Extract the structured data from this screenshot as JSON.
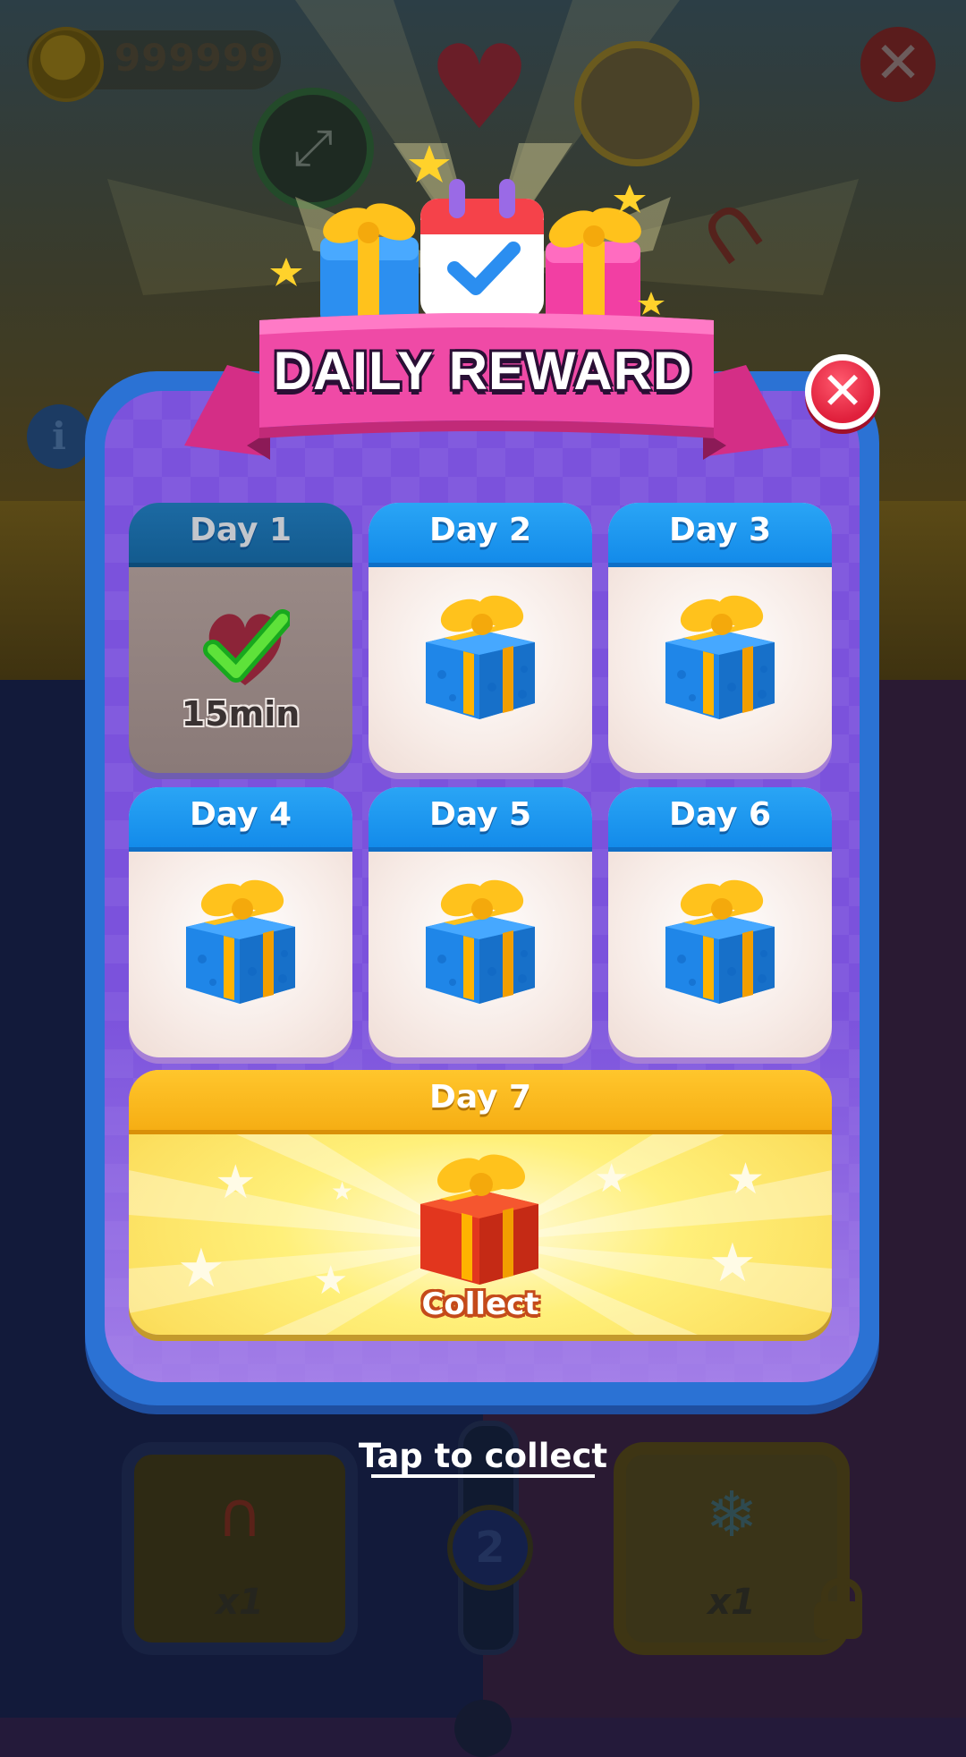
{
  "hud": {
    "coins": "999999",
    "coin_icon": "coin-icon",
    "close_icon": "close-icon",
    "info_label": "i"
  },
  "dialog": {
    "title": "DAILY REWARD",
    "close_icon": "close-icon",
    "days": [
      {
        "label": "Day 1",
        "status": "claimed",
        "reward_text": "15min",
        "icon": "heart-icon"
      },
      {
        "label": "Day 2",
        "status": "locked",
        "icon": "gift-icon"
      },
      {
        "label": "Day 3",
        "status": "locked",
        "icon": "gift-icon"
      },
      {
        "label": "Day 4",
        "status": "locked",
        "icon": "gift-icon"
      },
      {
        "label": "Day 5",
        "status": "locked",
        "icon": "gift-icon"
      },
      {
        "label": "Day 6",
        "status": "locked",
        "icon": "gift-icon"
      }
    ],
    "day7": {
      "label": "Day 7",
      "action": "Collect",
      "icon": "gift-icon"
    },
    "tap_hint": "Tap to collect"
  },
  "boosters": {
    "left": {
      "icon": "magnet-icon",
      "count": "x1"
    },
    "right": {
      "icon": "snowflake-icon",
      "count": "x1",
      "locked": true
    },
    "level": "2"
  },
  "colors": {
    "dialog_border": "#2b72d4",
    "dialog_fill": "#7b52dc",
    "ribbon": "#e83d9c",
    "day_header": "#1e9cf0",
    "day7_header": "#fbb81e",
    "close_button": "#e8284a"
  }
}
